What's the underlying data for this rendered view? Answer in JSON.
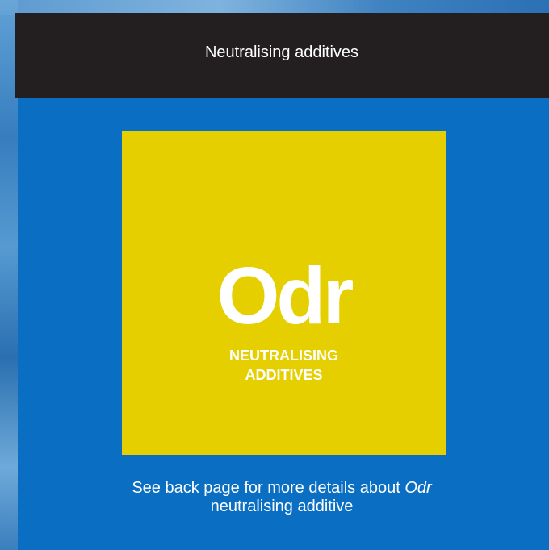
{
  "header": {
    "title": "Neutralising additives"
  },
  "tile": {
    "symbol": "Odr",
    "label_line1": "NEUTRALISING",
    "label_line2": "ADDITIVES"
  },
  "footer": {
    "line1_prefix": "See back page for more details about ",
    "line1_emphasis": "Odr",
    "line2": "neutralising additive"
  },
  "colors": {
    "background": "#0a6fc2",
    "header": "#231f20",
    "tile": "#e5cf00",
    "text": "#ffffff"
  }
}
